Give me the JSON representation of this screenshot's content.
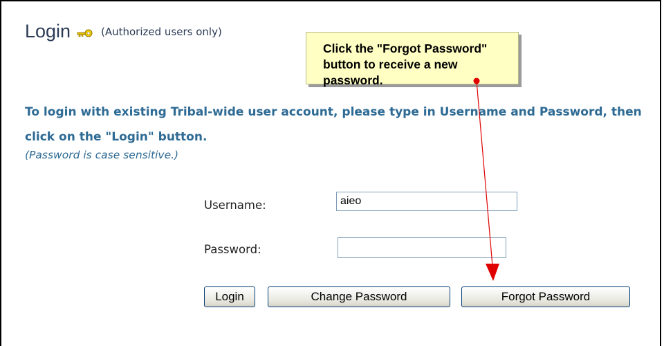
{
  "header": {
    "title": "Login",
    "subtitle": "(Authorized users only)",
    "icon": "key-icon"
  },
  "callout": {
    "text": "Click the \"Forgot Password\" button to receive a new password.",
    "background": "#ffffc4"
  },
  "instructions": {
    "main": "To login with existing Tribal-wide user account, please type in Username and Password, then click on the \"Login\" button.",
    "note": "(Password is case sensitive.)"
  },
  "form": {
    "username_label": "Username:",
    "username_value": "aieo",
    "password_label": "Password:",
    "password_value": ""
  },
  "buttons": {
    "login": "Login",
    "change_password": "Change Password",
    "forgot_password": "Forgot Password"
  },
  "colors": {
    "title": "#2a3a55",
    "instruction": "#2d6a94",
    "arrow": "#e00000"
  }
}
